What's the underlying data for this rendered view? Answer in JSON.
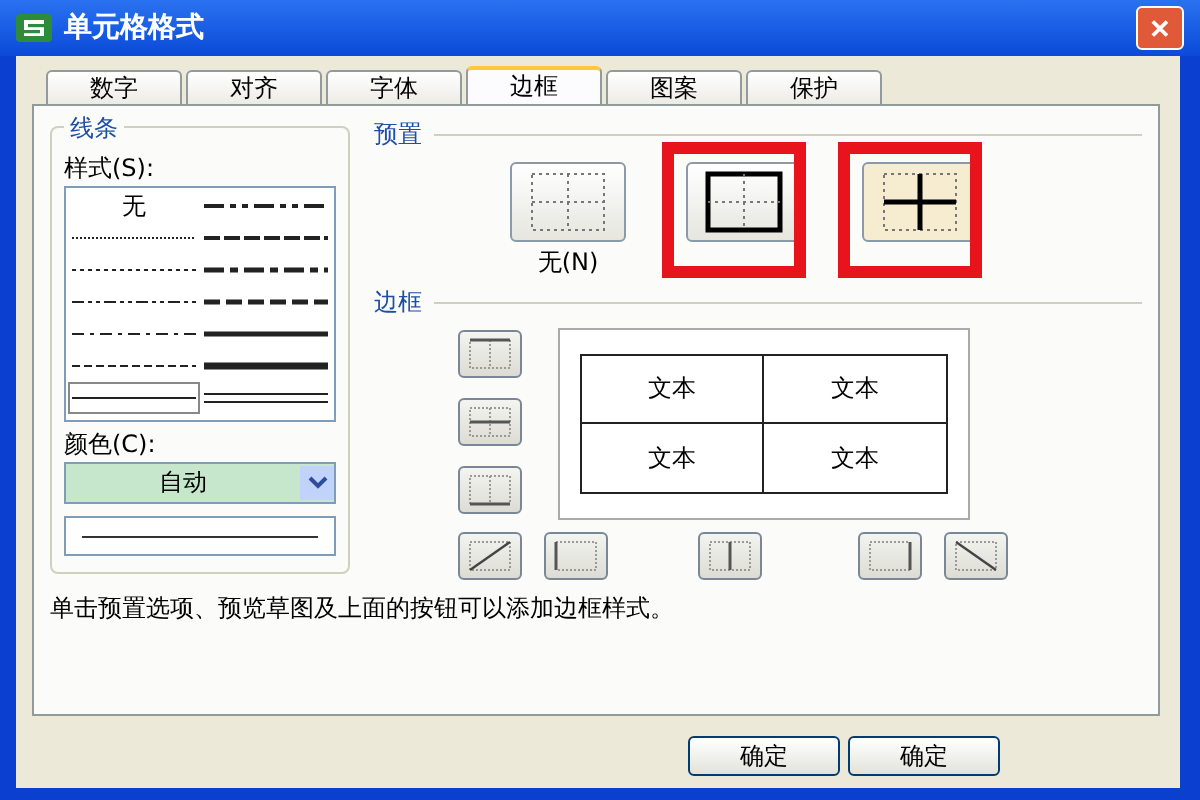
{
  "window": {
    "title": "单元格格式",
    "close": "✕"
  },
  "tabs": [
    {
      "label": "数字",
      "selected": false
    },
    {
      "label": "对齐",
      "selected": false
    },
    {
      "label": "字体",
      "selected": false
    },
    {
      "label": "边框",
      "selected": true
    },
    {
      "label": "图案",
      "selected": false
    },
    {
      "label": "保护",
      "selected": false
    }
  ],
  "line": {
    "title": "线条",
    "style_label": "样式(S):",
    "styles": [
      {
        "kind": "none",
        "label": "无",
        "selected": false
      },
      {
        "kind": "dashdotdot",
        "selected": false
      },
      {
        "kind": "hair",
        "selected": false
      },
      {
        "kind": "slant",
        "selected": false
      },
      {
        "kind": "dotted",
        "selected": false
      },
      {
        "kind": "mdashdot",
        "selected": false
      },
      {
        "kind": "dashdotdotthin",
        "selected": false
      },
      {
        "kind": "mdashed",
        "selected": false
      },
      {
        "kind": "dashdot",
        "selected": false
      },
      {
        "kind": "medium",
        "selected": false
      },
      {
        "kind": "dashed",
        "selected": false
      },
      {
        "kind": "thick",
        "selected": false
      },
      {
        "kind": "thin",
        "selected": true
      },
      {
        "kind": "double",
        "selected": false
      }
    ],
    "color_label": "颜色(C):",
    "color_value": "自动",
    "color": "#c6e7cc"
  },
  "presets": {
    "title": "预置",
    "items": [
      {
        "kind": "none",
        "label": "无(N)",
        "highlighted": false
      },
      {
        "kind": "outline",
        "highlighted": true
      },
      {
        "kind": "inside",
        "highlighted": true
      }
    ]
  },
  "border": {
    "title": "边框",
    "side_buttons": [
      {
        "kind": "top"
      },
      {
        "kind": "middle"
      },
      {
        "kind": "bottom"
      }
    ],
    "bottom_buttons": [
      {
        "kind": "diagup"
      },
      {
        "kind": "left"
      },
      {
        "kind": "center"
      },
      {
        "kind": "right"
      },
      {
        "kind": "diagdown"
      }
    ],
    "preview": [
      "文本",
      "文本",
      "文本",
      "文本"
    ]
  },
  "hint": "单击预置选项、预览草图及上面的按钮可以添加边框样式。",
  "buttons": [
    "确定",
    "确定"
  ]
}
